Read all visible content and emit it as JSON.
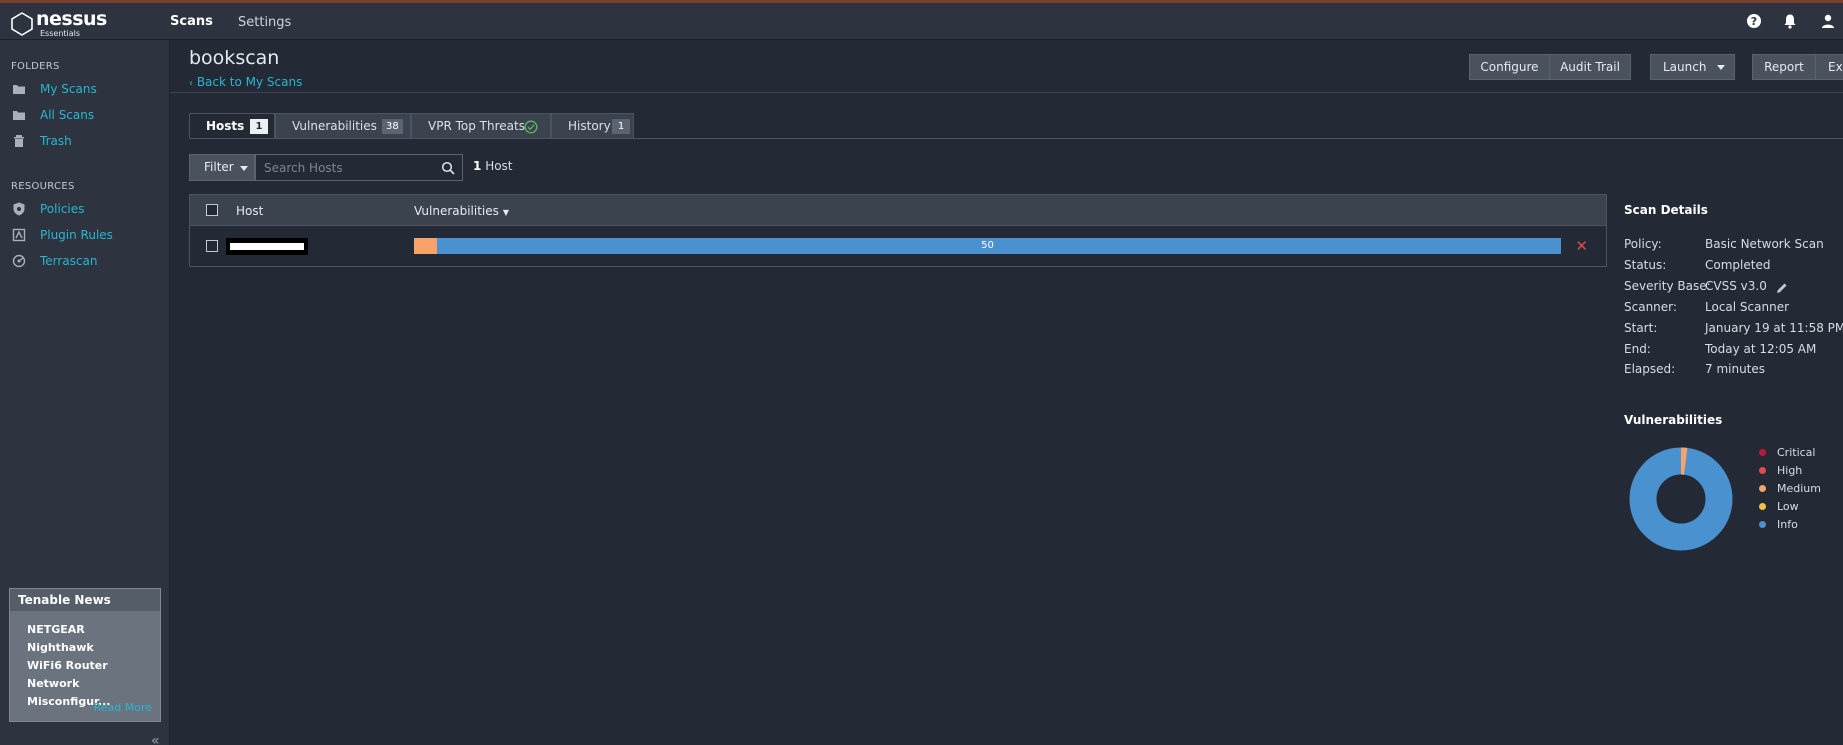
{
  "app": {
    "name": "nessus",
    "edition": "Essentials"
  },
  "nav": {
    "scans": "Scans",
    "settings": "Settings"
  },
  "topbar": {
    "help_icon": "help-icon",
    "bell_icon": "bell-icon",
    "user_icon": "user-icon"
  },
  "sidebar": {
    "folders_title": "FOLDERS",
    "folders": [
      {
        "label": "My Scans",
        "icon": "folder-icon"
      },
      {
        "label": "All Scans",
        "icon": "folder-icon"
      },
      {
        "label": "Trash",
        "icon": "trash-icon"
      }
    ],
    "resources_title": "RESOURCES",
    "resources": [
      {
        "label": "Policies",
        "icon": "shield-icon"
      },
      {
        "label": "Plugin Rules",
        "icon": "plugin-rules-icon"
      },
      {
        "label": "Terrascan",
        "icon": "terrascan-icon"
      }
    ],
    "news": {
      "title": "Tenable News",
      "lines": [
        "NETGEAR Nighthawk",
        "WiFi6 Router",
        "Network",
        "Misconfigur..."
      ],
      "read_more": "Read More"
    }
  },
  "page": {
    "title": "bookscan",
    "back_link": "Back to My Scans"
  },
  "toolbar": {
    "configure": "Configure",
    "audit_trail": "Audit Trail",
    "launch": "Launch",
    "report": "Report",
    "export": "Ex"
  },
  "tabs": [
    {
      "label": "Hosts",
      "badge": "1"
    },
    {
      "label": "Vulnerabilities",
      "badge": "38"
    },
    {
      "label": "VPR Top Threats",
      "badge": ""
    },
    {
      "label": "History",
      "badge": "1"
    }
  ],
  "filter": {
    "label": "Filter",
    "search_placeholder": "Search Hosts",
    "count_num": "1",
    "count_label": "Host"
  },
  "table": {
    "headers": {
      "host": "Host",
      "vulnerabilities": "Vulnerabilities"
    },
    "rows": [
      {
        "host": "[redacted]",
        "info_count": "50",
        "medium_fraction": 0.02
      }
    ]
  },
  "scan_details": {
    "title": "Scan Details",
    "items": [
      {
        "key": "Policy:",
        "value": "Basic Network Scan"
      },
      {
        "key": "Status:",
        "value": "Completed"
      },
      {
        "key": "Severity Base:",
        "value": "CVSS v3.0"
      },
      {
        "key": "Scanner:",
        "value": "Local Scanner"
      },
      {
        "key": "Start:",
        "value": "January 19 at 11:58 PM"
      },
      {
        "key": "End:",
        "value": "Today at 12:05 AM"
      },
      {
        "key": "Elapsed:",
        "value": "7 minutes"
      }
    ]
  },
  "vuln_chart": {
    "title": "Vulnerabilities",
    "legend": [
      {
        "label": "Critical",
        "color": "#c0163c"
      },
      {
        "label": "High",
        "color": "#e04b4b"
      },
      {
        "label": "Medium",
        "color": "#f6a268"
      },
      {
        "label": "Low",
        "color": "#f6c244"
      },
      {
        "label": "Info",
        "color": "#4a91cf"
      }
    ],
    "medium_fraction": 0.02
  }
}
